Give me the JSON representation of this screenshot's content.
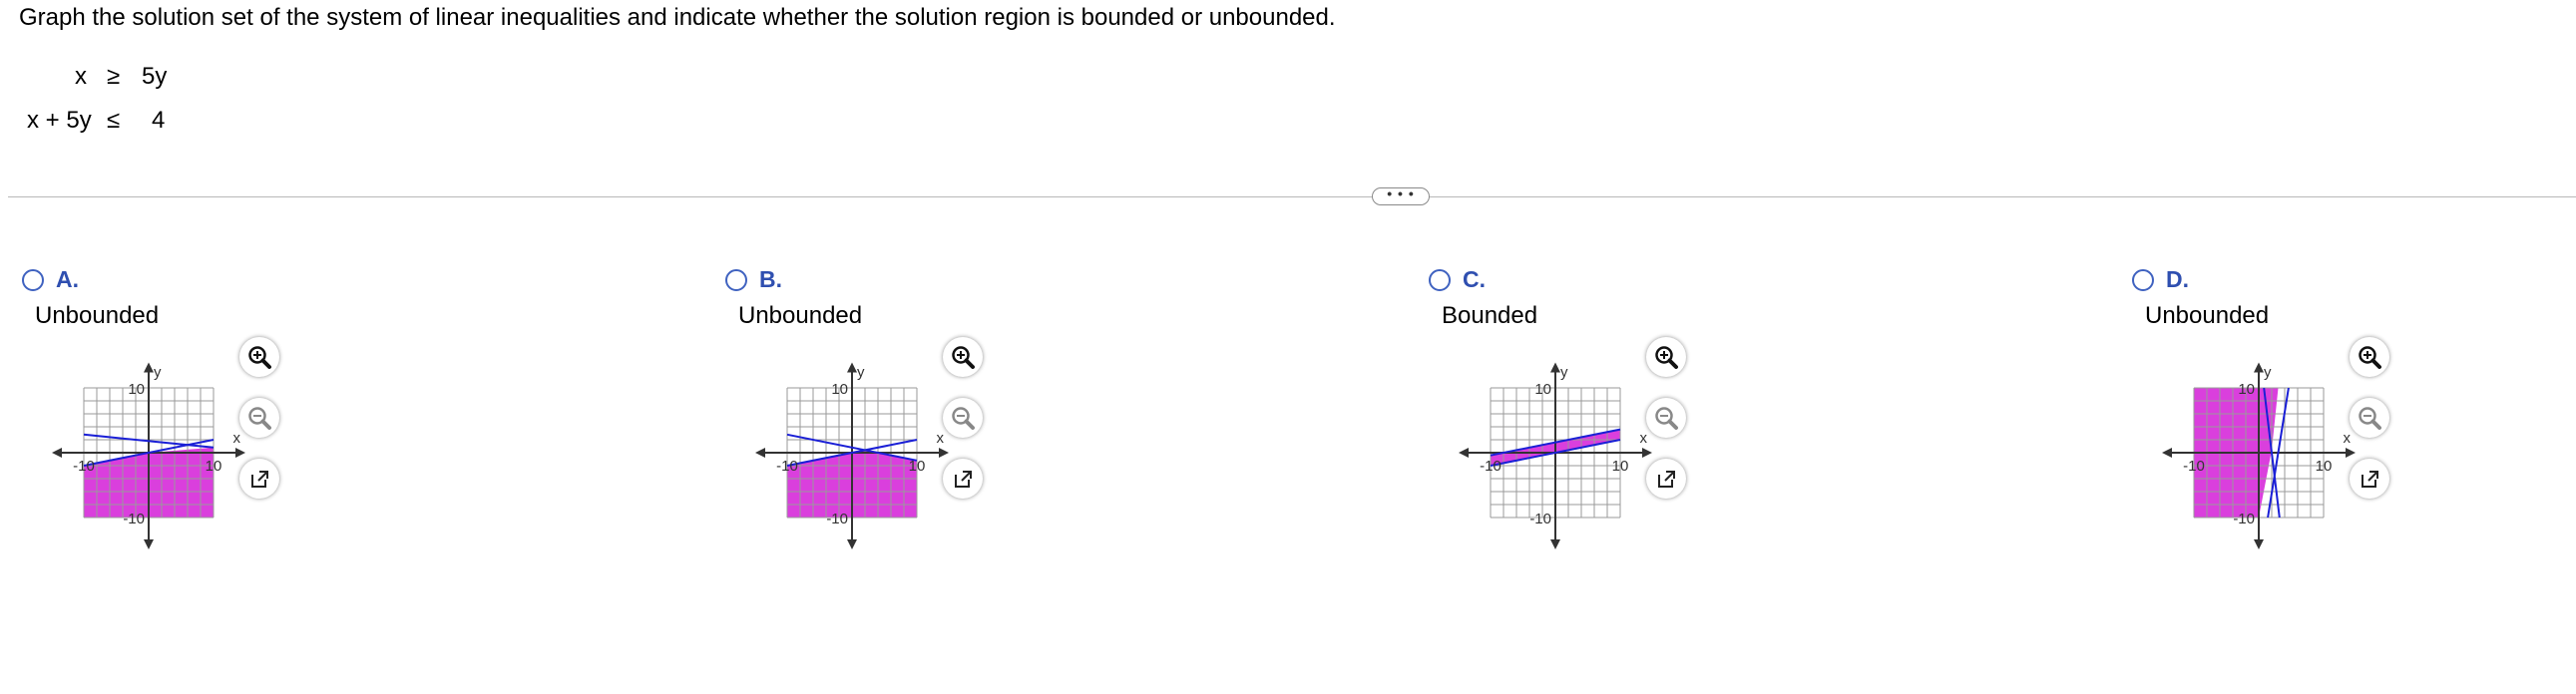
{
  "question": "Graph the solution set of the system of linear inequalities and indicate whether the solution region is bounded or unbounded.",
  "system": [
    {
      "lhs": "x",
      "op": "≥",
      "rhs": "5y"
    },
    {
      "lhs": "x + 5y",
      "op": "≤",
      "rhs": "4"
    }
  ],
  "expand_label": "• • •",
  "options": [
    {
      "letter": "A.",
      "status": "Unbounded"
    },
    {
      "letter": "B.",
      "status": "Unbounded"
    },
    {
      "letter": "C.",
      "status": "Bounded"
    },
    {
      "letter": "D.",
      "status": "Unbounded"
    }
  ],
  "graph_labels": {
    "x": "x",
    "y": "y",
    "pos": "10",
    "neg": "-10"
  },
  "colors": {
    "shade": "#d62ad9",
    "line": "#1a1fd6",
    "grid": "#9a9a9a",
    "option_letter": "#2f4fb0"
  },
  "icons": {
    "zoom_in": "zoom-in-icon",
    "zoom_out": "zoom-out-icon",
    "popout": "external-link-icon"
  }
}
